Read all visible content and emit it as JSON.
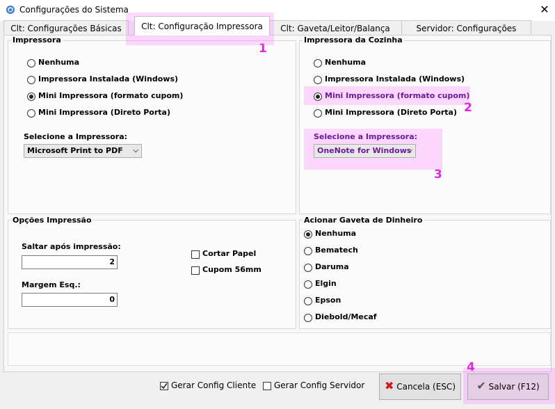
{
  "window": {
    "title": "Configurações do Sistema",
    "close": "✕"
  },
  "tabs": [
    {
      "label": "Clt: Configurações Básicas"
    },
    {
      "label": "Clt: Configuração Impressora"
    },
    {
      "label": "Clt: Gaveta/Leitor/Balança"
    },
    {
      "label": "Servidor: Configurações"
    }
  ],
  "impressora": {
    "title": "Impressora",
    "options": [
      "Nenhuma",
      "Impressora Instalada (Windows)",
      "Mini Impressora (formato cupom)",
      "Mini Impressora (Direto Porta)"
    ],
    "selected_index": 2,
    "select_label": "Selecione a Impressora:",
    "select_value": "Microsoft Print to PDF"
  },
  "cozinha": {
    "title": "Impressora da Cozinha",
    "options": [
      "Nenhuma",
      "Impressora Instalada (Windows)",
      "Mini Impressora (formato cupom)",
      "Mini Impressora (Direto Porta)"
    ],
    "selected_index": 2,
    "select_label": "Selecione a Impressora:",
    "select_value": "OneNote for Windows"
  },
  "opcoes": {
    "title": "Opções Impressão",
    "saltar_label": "Saltar após impressão:",
    "saltar_value": "2",
    "margem_label": "Margem Esq.:",
    "margem_value": "0",
    "cortar_label": "Cortar Papel",
    "cupom_label": "Cupom 56mm"
  },
  "gaveta": {
    "title": "Acionar Gaveta de Dinheiro",
    "options": [
      "Nenhuma",
      "Bematech",
      "Daruma",
      "Elgin",
      "Epson",
      "Diebold/Mecaf"
    ],
    "selected_index": 0
  },
  "footer": {
    "gerar_cliente": "Gerar Config Cliente",
    "gerar_cliente_checked": true,
    "gerar_servidor": "Gerar Config Servidor",
    "gerar_servidor_checked": false,
    "cancel": "Cancela (ESC)",
    "save": "Salvar (F12)"
  },
  "markers": [
    "1",
    "2",
    "3",
    "4"
  ],
  "colors": {
    "highlight": "#ff78ff",
    "marker": "#e426e4",
    "cancel_icon": "#d01818",
    "save_icon": "#555555"
  }
}
